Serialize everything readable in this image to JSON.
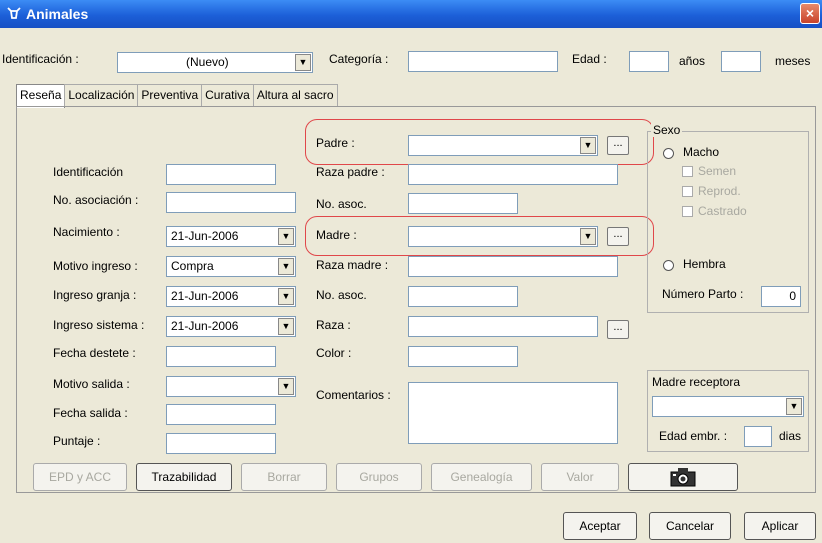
{
  "window": {
    "title": "Animales",
    "close": "×"
  },
  "top": {
    "id_label": "Identificación :",
    "id_value": "(Nuevo)",
    "categoria_label": "Categoría :",
    "edad_label": "Edad :",
    "anos_label": "años",
    "meses_label": "meses"
  },
  "tabs": [
    "Reseña",
    "Localización",
    "Preventiva",
    "Curativa",
    "Altura al sacro"
  ],
  "left": {
    "identificacion": "Identificación",
    "asociacion": "No. asociación :",
    "nacimiento": "Nacimiento :",
    "nacimiento_val": "21-Jun-2006",
    "motivo_ingreso": "Motivo ingreso :",
    "motivo_ingreso_val": "Compra",
    "ingreso_granja": "Ingreso granja :",
    "ingreso_granja_val": "21-Jun-2006",
    "ingreso_sistema": "Ingreso sistema :",
    "ingreso_sistema_val": "21-Jun-2006",
    "fecha_destete": "Fecha destete :",
    "motivo_salida": "Motivo salida :",
    "fecha_salida": "Fecha salida :",
    "puntaje": "Puntaje :"
  },
  "mid": {
    "padre": "Padre :",
    "raza_padre": "Raza padre :",
    "no_asoc1": "No. asoc.",
    "madre": "Madre :",
    "raza_madre": "Raza madre :",
    "no_asoc2": "No. asoc.",
    "raza": "Raza :",
    "color": "Color :",
    "comentarios": "Comentarios :",
    "ellipsis": "..."
  },
  "sexo": {
    "title": "Sexo",
    "macho": "Macho",
    "semen": "Semen",
    "reprod": "Reprod.",
    "castrado": "Castrado",
    "hembra": "Hembra",
    "numero_parto_label": "Número Parto :",
    "numero_parto_val": "0"
  },
  "receptora": {
    "title": "Madre receptora",
    "edad_embr": "Edad embr. :",
    "dias": "dias"
  },
  "actions": {
    "epd": "EPD y ACC",
    "trazabilidad": "Trazabilidad",
    "borrar": "Borrar",
    "grupos": "Grupos",
    "genealogia": "Genealogía",
    "valor": "Valor",
    "camera_icon": "camera-icon"
  },
  "footer": {
    "aceptar": "Aceptar",
    "cancelar": "Cancelar",
    "aplicar": "Aplicar"
  },
  "colors": {
    "titlebar": "#1c5fd8",
    "highlight": "#e0474a",
    "background": "#ece9d8"
  }
}
